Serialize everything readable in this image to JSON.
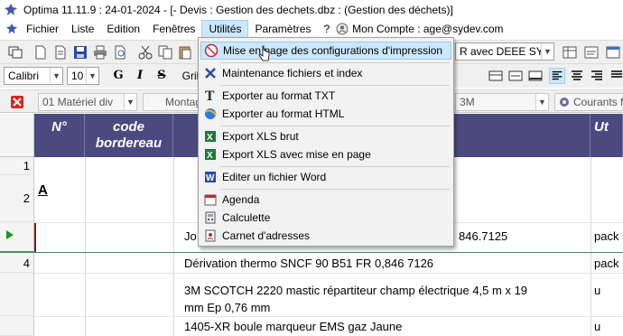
{
  "window": {
    "title": "Optima 11.11.9 : 24-01-2024 - [- Devis : Gestion des dechets.dbz :  (Gestion des déchets)]"
  },
  "menubar": {
    "items": [
      "Fichier",
      "Liste",
      "Edition",
      "Fenêtres",
      "Utilités",
      "Paramètres",
      "?"
    ],
    "account": "Mon Compte : age@sydev.com"
  },
  "toolbar": {
    "project_combo": "R avec DEEE SYD",
    "font_name": "Calibri",
    "font_size": "10",
    "bold": "G",
    "italic": "I",
    "strike": "S",
    "grid_label": "Gril",
    "filter1": "01 Matériel div",
    "filter2": "Montag",
    "filter3": "3M",
    "filter4": "Courants f"
  },
  "grid": {
    "headers": {
      "num": "N°",
      "code": "code bordereau",
      "unit": "Ut"
    },
    "rows": [
      {
        "n": "1",
        "num": "",
        "designation": "",
        "unit": ""
      },
      {
        "n": "2",
        "num": "A",
        "designation": "",
        "unit": ""
      },
      {
        "n": "",
        "num": "",
        "designation": "Jo",
        "designation_tail": "846.7125",
        "unit": "pack"
      },
      {
        "n": "4",
        "num": "",
        "designation": "Dérivation thermo SNCF 90 B51 FR 0,846 7126",
        "unit": "pack"
      },
      {
        "n": "",
        "num": "",
        "designation": "3M SCOTCH 2220 mastic répartiteur champ électrique 4,5 m x 19",
        "designation2": "mm Ep 0,76 mm",
        "unit": "u"
      },
      {
        "n": "",
        "num": "",
        "designation": "1405-XR boule marqueur EMS gaz Jaune",
        "unit": "u"
      }
    ]
  },
  "utilites_menu": {
    "items": [
      {
        "label": "Mise en page des configurations d'impression",
        "icon": "print-config-icon",
        "highlighted": true
      },
      {
        "label": "Maintenance fichiers et index",
        "icon": "maintenance-tools-icon"
      },
      {
        "label": "Exporter au format TXT",
        "icon": "txt-export-icon"
      },
      {
        "label": "Exporter au format HTML",
        "icon": "html-export-icon"
      },
      {
        "label": "Export XLS brut",
        "icon": "xls-icon"
      },
      {
        "label": "Export XLS avec mise en page",
        "icon": "xls-layout-icon"
      },
      {
        "label": "Editer un fichier Word",
        "icon": "word-icon"
      },
      {
        "label": "Agenda",
        "icon": "agenda-icon"
      },
      {
        "label": "Calculette",
        "icon": "calculator-icon"
      },
      {
        "label": "Carnet d'adresses",
        "icon": "address-book-icon"
      }
    ]
  }
}
